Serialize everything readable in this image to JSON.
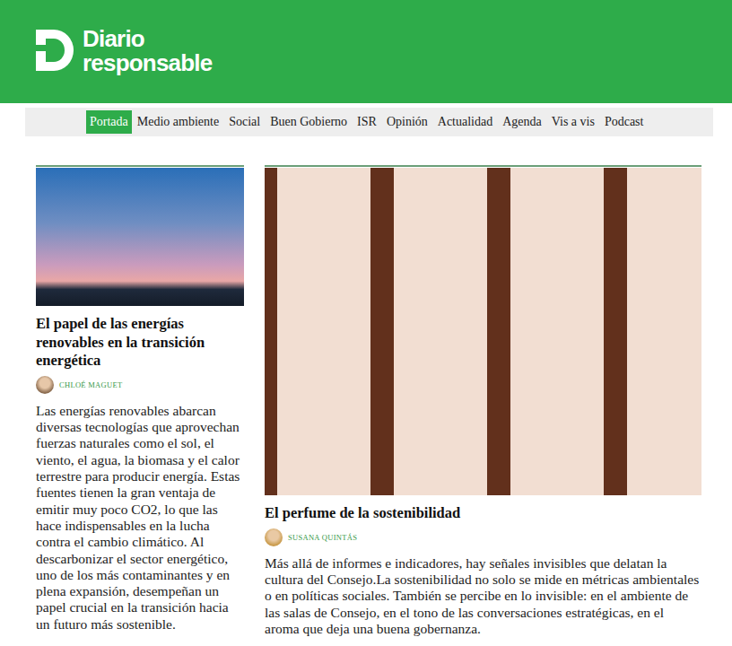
{
  "site": {
    "logo_lines": [
      "Diario",
      "responsable"
    ]
  },
  "nav": [
    {
      "label": "Portada",
      "selected": true
    },
    {
      "label": "Medio ambiente",
      "selected": false
    },
    {
      "label": "Social",
      "selected": false
    },
    {
      "label": "Buen Gobierno",
      "selected": false
    },
    {
      "label": "ISR",
      "selected": false
    },
    {
      "label": "Opinión",
      "selected": false
    },
    {
      "label": "Actualidad",
      "selected": false
    },
    {
      "label": "Agenda",
      "selected": false
    },
    {
      "label": "Vis a vis",
      "selected": false
    },
    {
      "label": "Podcast",
      "selected": false
    }
  ],
  "side_article": {
    "title": "El papel de las energías renovables en la transición energética",
    "author": "CHLOÉ MAGUET",
    "excerpt": "Las energías renovables abarcan diversas tecnologías que aprovechan fuerzas naturales como el sol, el viento, el agua, la biomasa y el calor terrestre para producir energía. Estas fuentes tienen la gran ventaja de emitir muy poco CO2, lo que las hace indispensables en la lucha contra el cambio climático. Al descarbonizar el sector energético, uno de los más contaminantes y en plena expansión, desempeñan un papel crucial en la transición hacia un futuro más sostenible."
  },
  "featured_article": {
    "title": "El perfume de la sostenibilidad",
    "author": "SUSANA QUINTÁS",
    "excerpt": "Más allá de informes e indicadores, hay señales invisibles que delatan la cultura del Consejo.La sostenibilidad no solo se mide en métricas ambientales o en políticas sociales. También se percibe en lo invisible: en el ambiente de las salas de Consejo, en el tono de las conversaciones estratégicas, en el aroma que deja una buena gobernanza."
  }
}
